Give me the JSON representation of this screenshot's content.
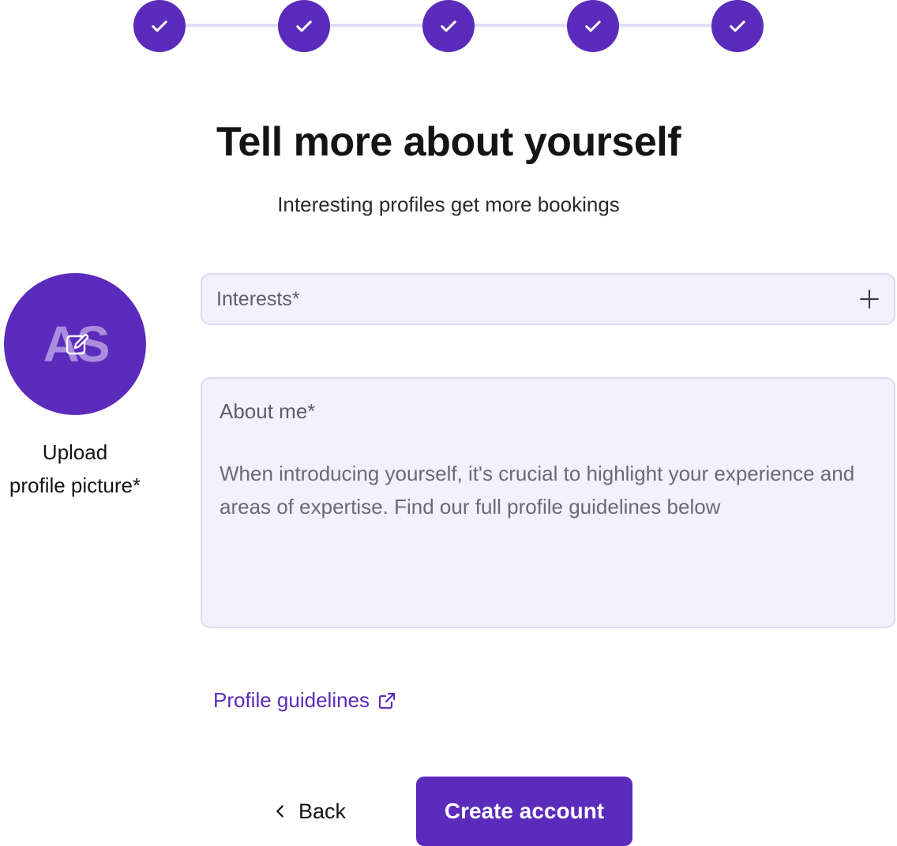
{
  "stepper": {
    "steps": [
      {
        "state": "completed",
        "icon": "check-icon"
      },
      {
        "state": "completed",
        "icon": "check-icon"
      },
      {
        "state": "completed",
        "icon": "check-icon"
      },
      {
        "state": "completed",
        "icon": "check-icon"
      },
      {
        "state": "completed",
        "icon": "check-icon"
      }
    ]
  },
  "header": {
    "title": "Tell more about yourself",
    "subtitle": "Interesting profiles get more bookings"
  },
  "avatar": {
    "initials": "AS",
    "upload_label_line1": "Upload",
    "upload_label_line2": "profile picture*",
    "icon": "edit-image-icon"
  },
  "form": {
    "interests_label": "Interests*",
    "interests_icon": "plus-icon",
    "about_label": "About me*",
    "about_placeholder": "When introducing yourself, it's crucial to highlight your experience and areas of expertise. Find our full profile guidelines below"
  },
  "links": {
    "guidelines_label": "Profile guidelines",
    "guidelines_icon": "external-link-icon"
  },
  "actions": {
    "back_label": "Back",
    "back_icon": "chevron-left-icon",
    "create_label": "Create account"
  },
  "colors": {
    "accent": "#5b2bbb",
    "field_background": "#f3f1fe",
    "field_border": "#dedaf2",
    "stepper_line": "#e2ddf7"
  }
}
